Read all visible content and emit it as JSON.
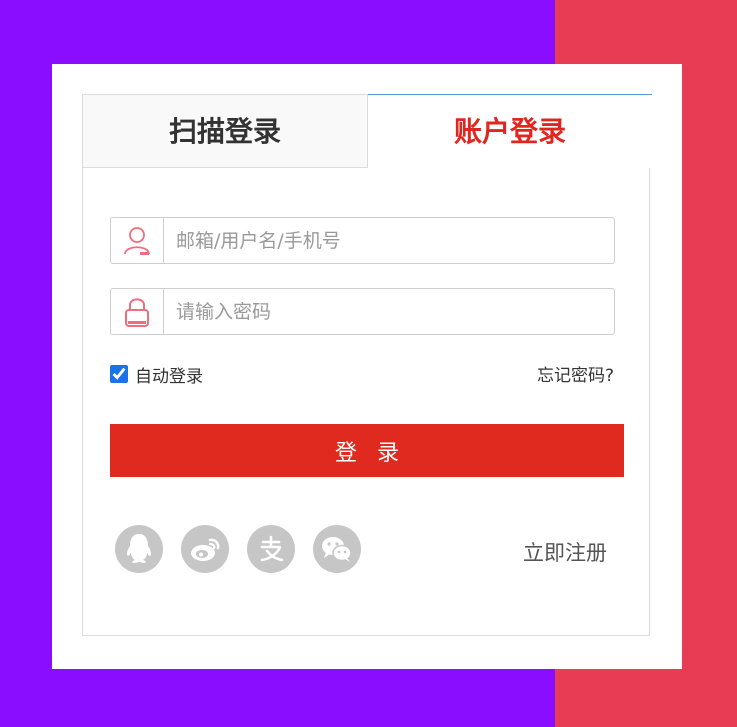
{
  "colors": {
    "bg_left": "#8a0dff",
    "bg_right": "#e83c55",
    "accent_red": "#e0291f",
    "icon_pink": "#f16d7e",
    "social_gray": "#c6c6c6"
  },
  "tabs": [
    {
      "label": "扫描登录",
      "active": false
    },
    {
      "label": "账户登录",
      "active": true
    }
  ],
  "form": {
    "username": {
      "placeholder": "邮箱/用户名/手机号",
      "value": "",
      "icon": "user-icon"
    },
    "password": {
      "placeholder": "请输入密码",
      "value": "",
      "icon": "lock-icon"
    },
    "remember_label": "自动登录",
    "remember_checked": true,
    "forgot_label": "忘记密码?",
    "submit_label": "登录"
  },
  "social": {
    "icons": [
      "qq-icon",
      "weibo-icon",
      "alipay-icon",
      "wechat-icon"
    ]
  },
  "register_label": "立即注册"
}
